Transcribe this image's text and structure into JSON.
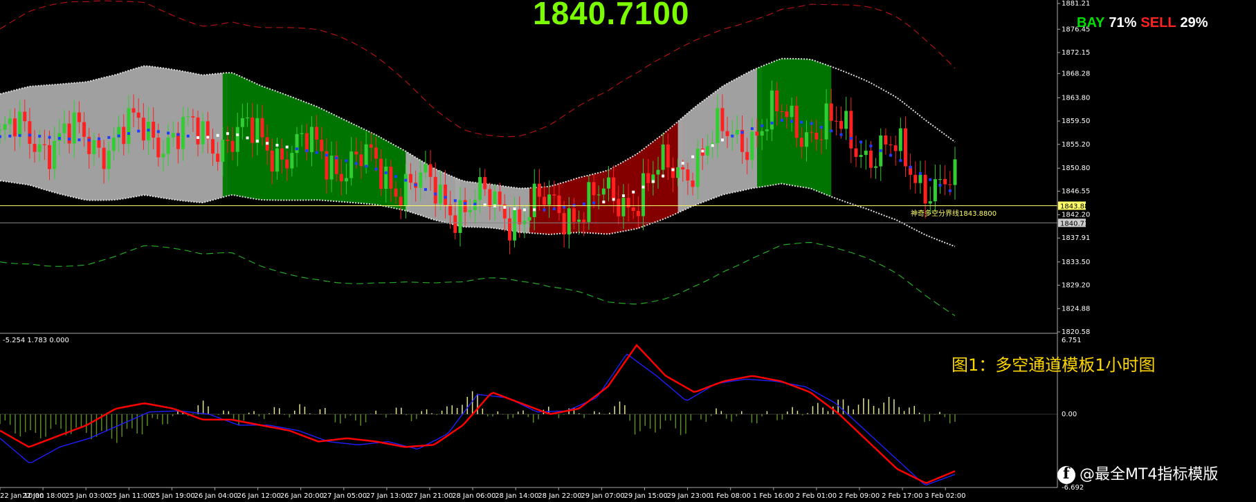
{
  "header": {
    "price": "1840.7100",
    "sentiment": {
      "buy_label": "BAY",
      "buy_pct": "71%",
      "sell_label": "SELL",
      "sell_pct": "29%"
    }
  },
  "caption": "图1：多空通道模板1小时图",
  "watermark": "@最全MT4指标模版",
  "indicator_label": "-5.254 1.783 0.000",
  "boundary_label": "神奇多空分界线1843.8800",
  "colors": {
    "background": "#000000",
    "bull_candle": "#32CD32",
    "bear_candle": "#FF2020",
    "band_grey": "#A9A9A9",
    "band_green": "#007A00",
    "band_red": "#8B0000",
    "dots_blue": "#1E3CFF",
    "dots_white": "#FFFFFF",
    "signal_red": "#FF0000",
    "macd_blue": "#1E1EFF",
    "hist_yellow": "#E6E68C",
    "hist_green": "#5A8C1E",
    "boundary_line": "#FFFF66"
  },
  "chart_data": {
    "type": "line",
    "price_axis": {
      "ticks": [
        "1881.21",
        "1876.45",
        "1872.15",
        "1868.28",
        "1863.80",
        "1859.50",
        "1855.20",
        "1850.80",
        "1846.55",
        "1842.20",
        "1837.91",
        "1833.50",
        "1829.20",
        "1824.88",
        "1820.58"
      ],
      "ylim": [
        1820.58,
        1881.21
      ],
      "labels": [
        {
          "text": "1843.88",
          "value": 1843.88,
          "color": "yellow"
        },
        {
          "text": "1840.71",
          "value": 1840.71,
          "color": "grey"
        }
      ]
    },
    "indicator_axis": {
      "ticks": [
        "6.751",
        "0.00",
        "-6.692"
      ],
      "ylim": [
        -6.692,
        6.751
      ]
    },
    "x_ticks": [
      "22 Jan 10:00",
      "22 Jan 18:00",
      "25 Jan 03:00",
      "25 Jan 11:00",
      "25 Jan 19:00",
      "26 Jan 04:00",
      "26 Jan 12:00",
      "26 Jan 20:00",
      "27 Jan 05:00",
      "27 Jan 13:00",
      "27 Jan 21:00",
      "28 Jan 06:00",
      "28 Jan 14:00",
      "28 Jan 22:00",
      "29 Jan 07:00",
      "29 Jan 15:00",
      "29 Jan 23:00",
      "1 Feb 08:00",
      "1 Feb 16:00",
      "2 Feb 01:00",
      "2 Feb 09:00",
      "2 Feb 17:00",
      "3 Feb 02:00"
    ],
    "series": [
      {
        "values": [
          1856.5,
          1856.8,
          1856.2,
          1855.8,
          1856.5,
          1857.8,
          1857.0,
          1856.2,
          1857.2,
          1855.5,
          1854.5,
          1853.5,
          1852.0,
          1850.5,
          1848.5,
          1846.0,
          1844.2,
          1843.8,
          1843.0,
          1843.0,
          1844.0,
          1844.5,
          1846.5,
          1849.5,
          1853.0,
          1856.0,
          1858.0,
          1859.5,
          1859.0,
          1857.0,
          1855.0,
          1852.5,
          1849.0,
          1846.0
        ]
      },
      {
        "values": [
          -2.2,
          -4.5,
          -3.0,
          -2.2,
          -1.0,
          0.2,
          0.3,
          0.0,
          -1.0,
          -1.0,
          -1.5,
          -2.5,
          -2.8,
          -2.5,
          -3.2,
          -1.8,
          1.8,
          1.5,
          0.2,
          0.3,
          1.5,
          5.5,
          3.5,
          1.2,
          2.8,
          3.2,
          3.0,
          2.5,
          1.0,
          -1.5,
          -4.0,
          -6.5,
          -5.5
        ]
      },
      {
        "values": [
          -1.5,
          -3.0,
          -2.0,
          -1.0,
          0.5,
          1.0,
          0.5,
          -0.5,
          -0.5,
          -1.0,
          -1.5,
          -2.5,
          -2.2,
          -2.5,
          -3.0,
          -2.8,
          -1.0,
          2.0,
          1.0,
          0.0,
          0.5,
          2.5,
          6.3,
          3.5,
          2.0,
          3.0,
          3.5,
          3.0,
          2.0,
          0.0,
          -2.5,
          -5.0,
          -6.3,
          -5.2
        ]
      }
    ]
  }
}
